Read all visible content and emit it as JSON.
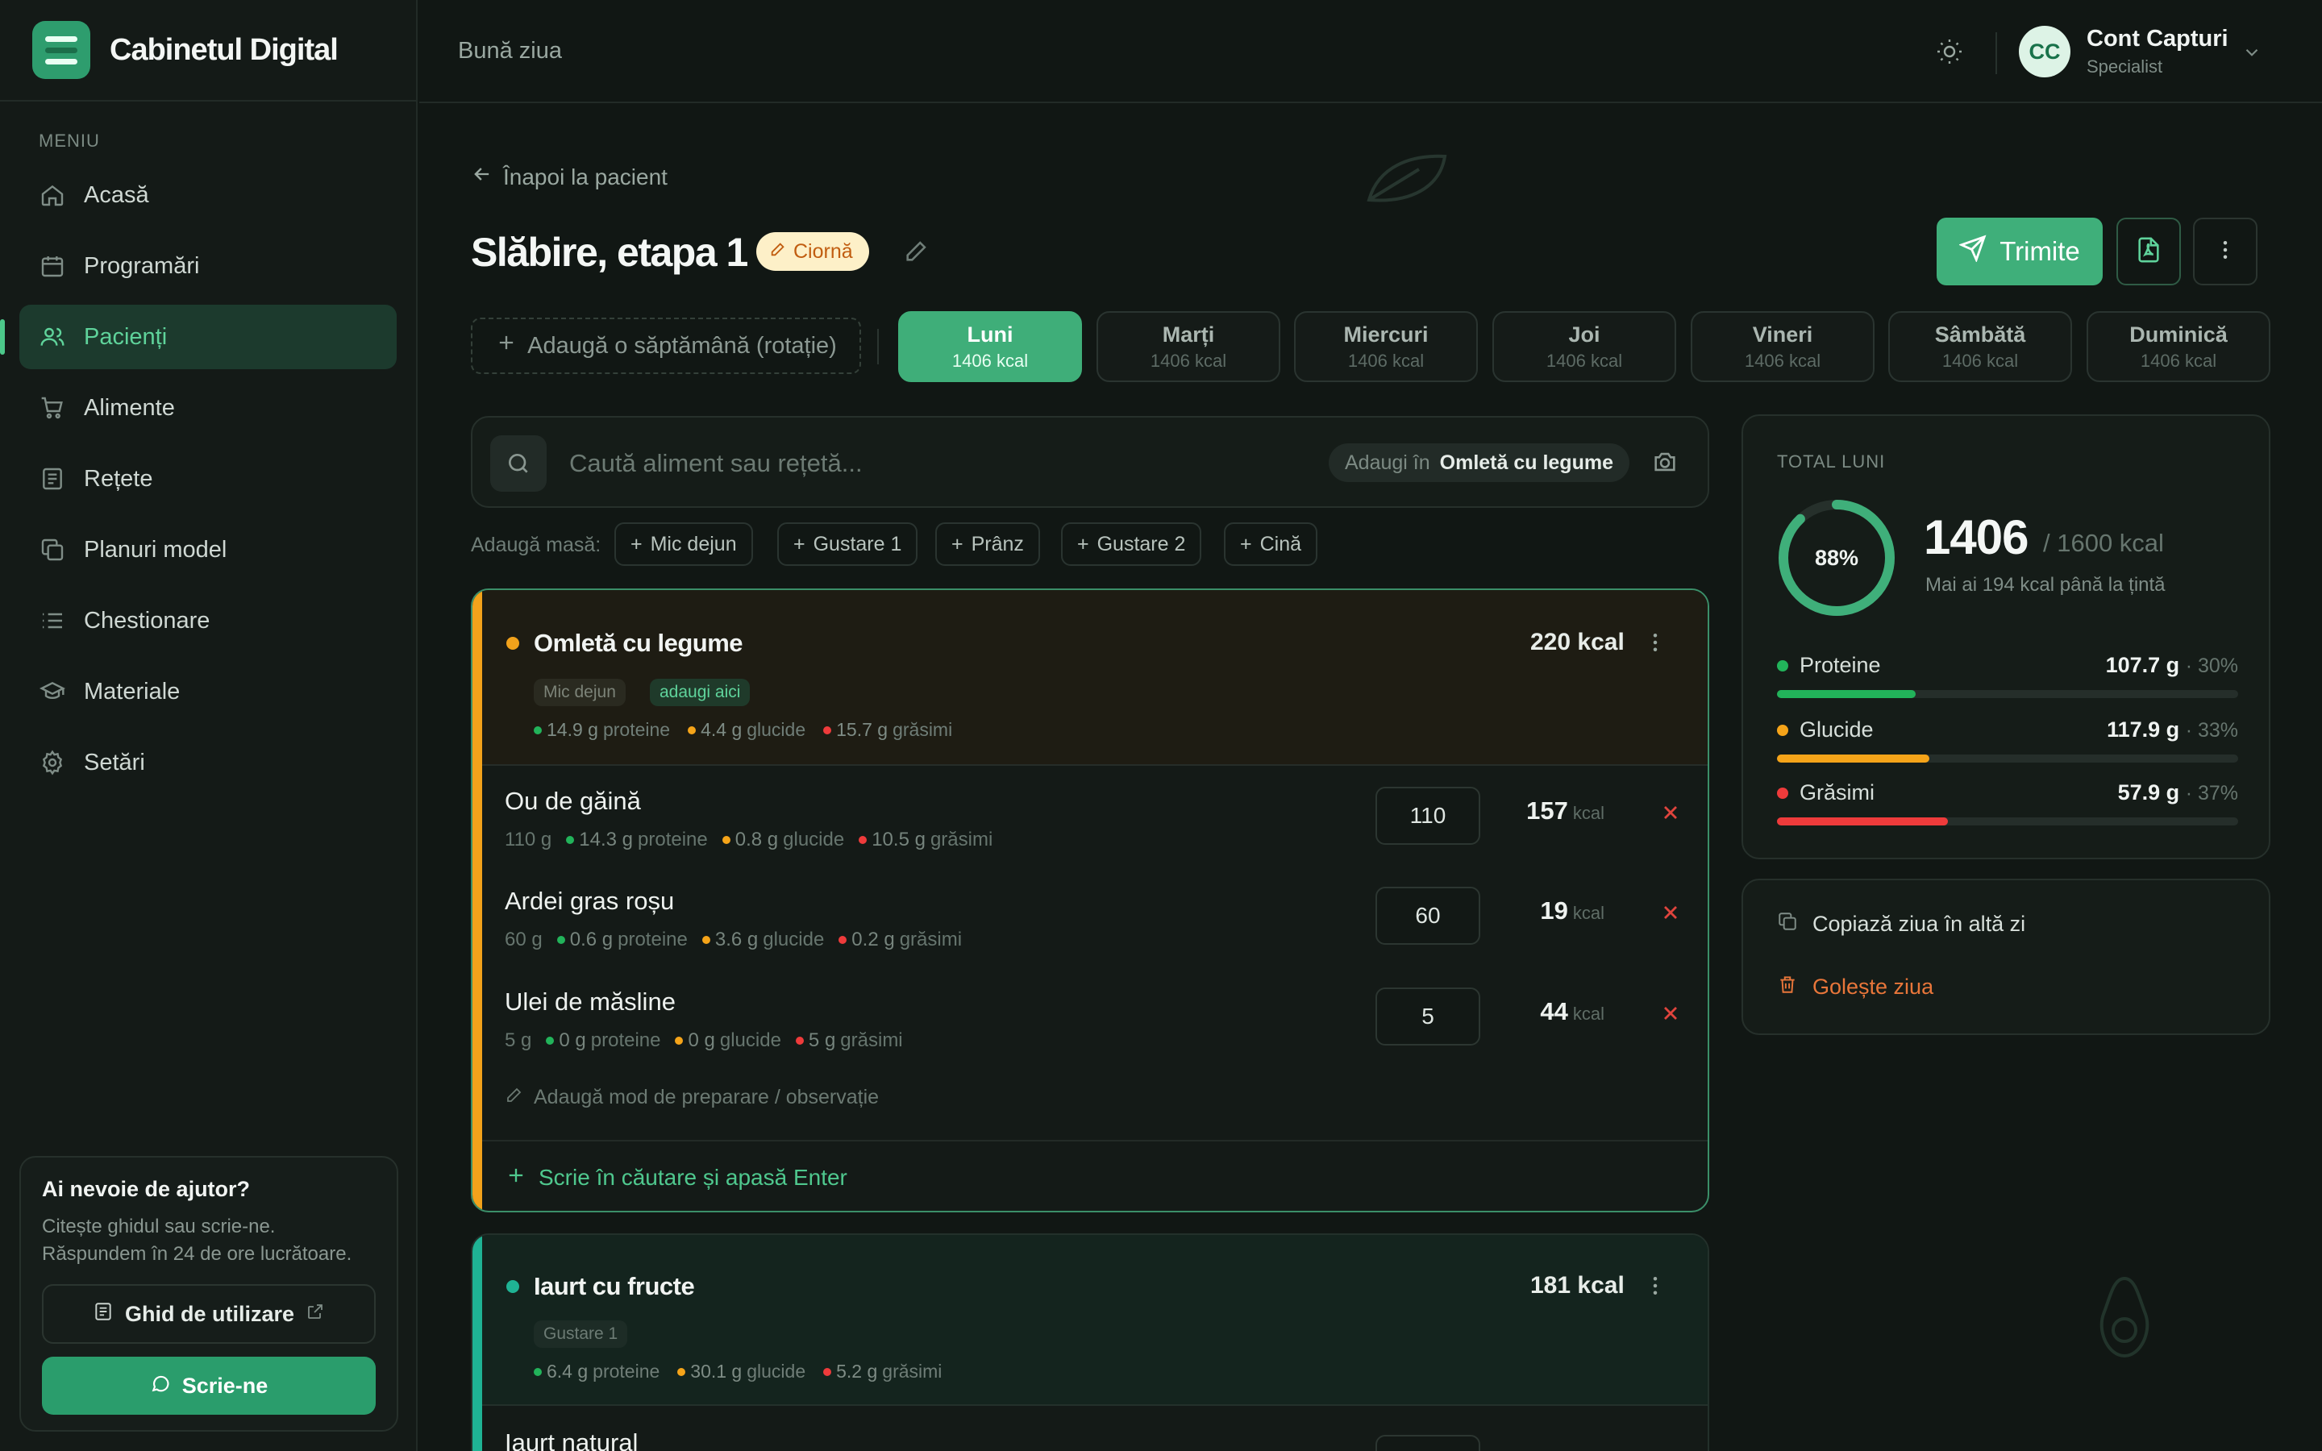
{
  "brand": {
    "name": "Cabinetul Digital"
  },
  "sidebar": {
    "menu_title": "MENIU",
    "items": [
      {
        "label": "Acasă",
        "icon": "home-icon"
      },
      {
        "label": "Programări",
        "icon": "calendar-icon"
      },
      {
        "label": "Pacienți",
        "icon": "users-icon",
        "active": true
      },
      {
        "label": "Alimente",
        "icon": "cart-icon"
      },
      {
        "label": "Rețete",
        "icon": "book-icon"
      },
      {
        "label": "Planuri model",
        "icon": "copy-icon"
      },
      {
        "label": "Chestionare",
        "icon": "list-icon"
      },
      {
        "label": "Materiale",
        "icon": "graduation-cap-icon"
      },
      {
        "label": "Setări",
        "icon": "gear-icon"
      }
    ],
    "help": {
      "title": "Ai nevoie de ajutor?",
      "text": "Citește ghidul sau scrie-ne. Răspundem în 24 de ore lucrătoare.",
      "guide_label": "Ghid de utilizare",
      "write_label": "Scrie-ne"
    }
  },
  "topbar": {
    "greeting": "Bună ziua",
    "user": {
      "initials": "CC",
      "name": "Cont Capturi",
      "role": "Specialist"
    }
  },
  "plan": {
    "back_label": "Înapoi la pacient",
    "title": "Slăbire, etapa 1",
    "status": "Ciornă",
    "send_label": "Trimite",
    "add_week_label": "Adaugă o săptămână (rotație)"
  },
  "days": [
    {
      "name": "Luni",
      "kcal": "1406 kcal",
      "active": true
    },
    {
      "name": "Marți",
      "kcal": "1406 kcal"
    },
    {
      "name": "Miercuri",
      "kcal": "1406 kcal"
    },
    {
      "name": "Joi",
      "kcal": "1406 kcal"
    },
    {
      "name": "Vineri",
      "kcal": "1406 kcal"
    },
    {
      "name": "Sâmbătă",
      "kcal": "1406 kcal"
    },
    {
      "name": "Duminică",
      "kcal": "1406 kcal"
    }
  ],
  "search": {
    "placeholder": "Caută aliment sau rețetă...",
    "add_into_label": "Adaugi în",
    "add_into_value": "Omletă cu legume"
  },
  "add_meal": {
    "label": "Adaugă masă:",
    "chips": [
      "Mic dejun",
      "Gustare 1",
      "Prânz",
      "Gustare 2",
      "Cină"
    ]
  },
  "meals": [
    {
      "name": "Omletă cu legume",
      "kcal": "220 kcal",
      "tag": "Mic dejun",
      "add_here": "adaugi aici",
      "macros": {
        "protein": "14.9 g",
        "carbs": "4.4 g",
        "fat": "15.7 g"
      },
      "foods": [
        {
          "name": "Ou de găină",
          "grams": "110 g",
          "protein": "14.3 g",
          "carbs": "0.8 g",
          "fat": "10.5 g",
          "qty": "110",
          "kcal": "157"
        },
        {
          "name": "Ardei gras roșu",
          "grams": "60 g",
          "protein": "0.6 g",
          "carbs": "3.6 g",
          "fat": "0.2 g",
          "qty": "60",
          "kcal": "19"
        },
        {
          "name": "Ulei de măsline",
          "grams": "5 g",
          "protein": "0 g",
          "carbs": "0 g",
          "fat": "5 g",
          "qty": "5",
          "kcal": "44"
        }
      ],
      "note_label": "Adaugă mod de preparare / observație",
      "enter_label": "Scrie în căutare și apasă Enter"
    },
    {
      "name": "Iaurt cu fructe",
      "kcal": "181 kcal",
      "tag": "Gustare 1",
      "macros": {
        "protein": "6.4 g",
        "carbs": "30.1 g",
        "fat": "5.2 g"
      },
      "first_food": "Iaurt natural"
    }
  ],
  "labels": {
    "protein": "proteine",
    "carbs": "glucide",
    "fat": "grăsimi",
    "kcal_unit": "kcal"
  },
  "totals": {
    "label": "TOTAL LUNI",
    "percent": "88%",
    "percent_value": 0.88,
    "kcal": "1406",
    "target": "/ 1600 kcal",
    "remaining": "Mai ai 194 kcal până la țintă",
    "macros": [
      {
        "name": "Proteine",
        "value": "107.7 g",
        "pct": "· 30%",
        "fill": 0.3,
        "color": "#22b35a"
      },
      {
        "name": "Glucide",
        "value": "117.9 g",
        "pct": "· 33%",
        "fill": 0.33,
        "color": "#f5a419"
      },
      {
        "name": "Grăsimi",
        "value": "57.9 g",
        "pct": "· 37%",
        "fill": 0.37,
        "color": "#ee3b3b"
      }
    ]
  },
  "day_actions": {
    "copy_label": "Copiază ziua în altă zi",
    "clear_label": "Golește ziua"
  },
  "colors": {
    "accent": "#3fae79",
    "protein": "#22b35a",
    "carbs": "#f5a419",
    "fat": "#ee3b3b",
    "danger": "#e0443d",
    "clear": "#e8763a"
  }
}
